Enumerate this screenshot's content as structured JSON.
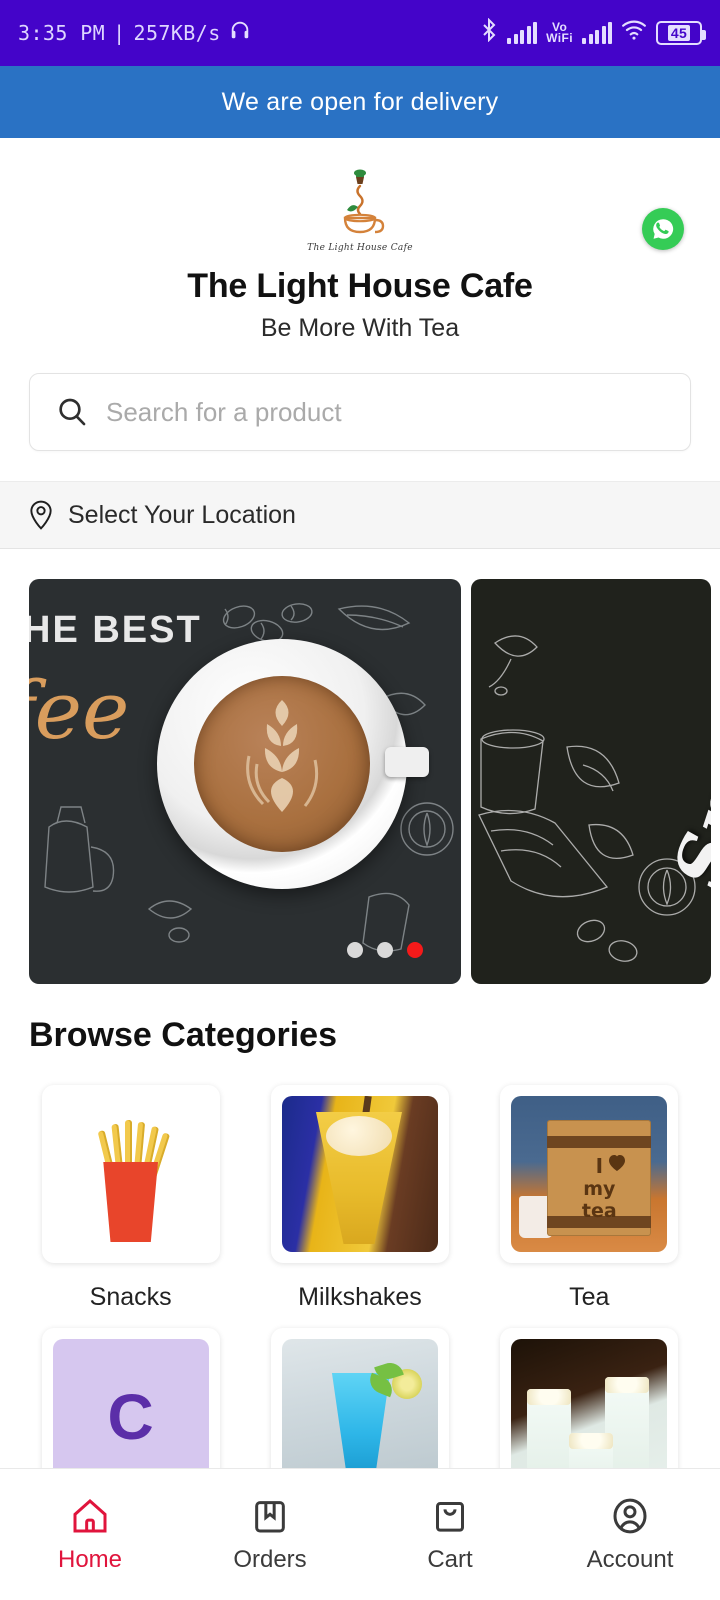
{
  "statusbar": {
    "time": "3:35 PM",
    "separator": "|",
    "network_speed": "257KB/s",
    "headphone_icon": "headphone-icon",
    "bluetooth_icon": "bluetooth-icon",
    "vowifi_line1": "Vo",
    "vowifi_line2": "WiFi",
    "wifi_icon": "wifi-icon",
    "battery_level": "45",
    "bg_color": "#4404c9"
  },
  "delivery_banner": {
    "text": "We are open for delivery",
    "bg_color": "#2a72c4"
  },
  "brand": {
    "logo_caption": "The Light House Cafe",
    "title": "The Light House Cafe",
    "tagline": "Be More With Tea",
    "whatsapp_label": "whatsapp-icon",
    "whatsapp_color": "#35cc56"
  },
  "search": {
    "placeholder": "Search for a product",
    "value": "",
    "icon": "search-icon"
  },
  "location": {
    "label": "Select Your Location",
    "icon": "location-pin-icon"
  },
  "carousel": {
    "slides": [
      {
        "headline": "HE BEST",
        "script": "fee",
        "alt": "best-coffee-banner"
      },
      {
        "script": "Smoo",
        "alt": "smooth-coffee-banner"
      }
    ],
    "dots": [
      {
        "active": false
      },
      {
        "active": false
      },
      {
        "active": true
      }
    ],
    "active_dot_color": "#f51a1a"
  },
  "categories_section": {
    "title": "Browse Categories",
    "items": [
      {
        "label": "Snacks",
        "thumb": "t-fries"
      },
      {
        "label": "Milkshakes",
        "thumb": "t-shake"
      },
      {
        "label": "Tea",
        "thumb": "t-tea"
      },
      {
        "label": "",
        "thumb": "t-c",
        "placeholder_letter": "C"
      },
      {
        "label": "",
        "thumb": "t-mojito"
      },
      {
        "label": "",
        "thumb": "t-lassi"
      }
    ],
    "tea_box_text_line1": "I",
    "tea_box_text_line2": "my",
    "tea_box_text_line3": "tea"
  },
  "bottom_nav": {
    "active_color": "#e0143c",
    "items": [
      {
        "label": "Home",
        "icon": "home-icon",
        "active": true
      },
      {
        "label": "Orders",
        "icon": "orders-icon",
        "active": false
      },
      {
        "label": "Cart",
        "icon": "cart-icon",
        "active": false
      },
      {
        "label": "Account",
        "icon": "account-icon",
        "active": false
      }
    ]
  }
}
